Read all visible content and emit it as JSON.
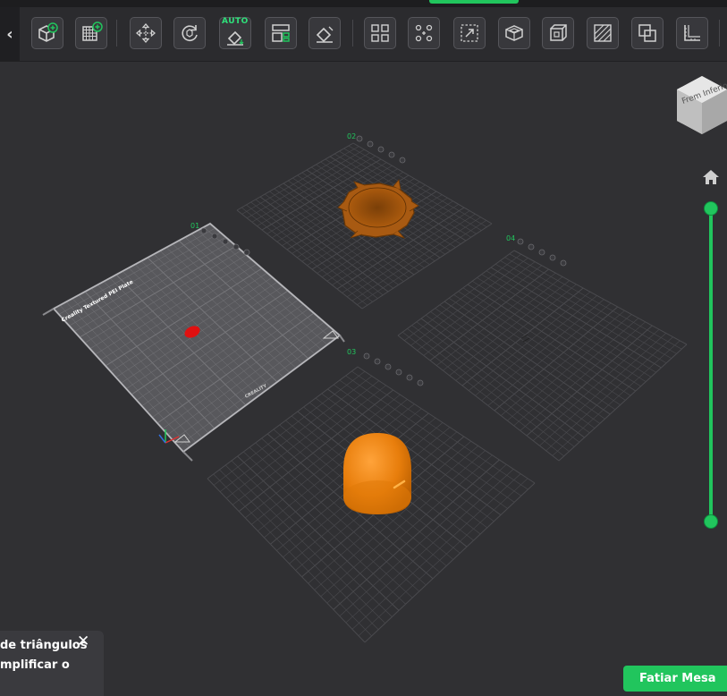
{
  "toolbar": {
    "collapse_glyph": "‹",
    "auto_label": "AUTO",
    "buttons": [
      {
        "name": "add-model-button",
        "icon": "cube-plus-icon"
      },
      {
        "name": "add-plate-button",
        "icon": "grid-plus-icon"
      },
      {
        "name": "move-button",
        "icon": "move-arrows-icon"
      },
      {
        "name": "rotate-button",
        "icon": "rotate-icon"
      },
      {
        "name": "auto-orient-button",
        "icon": "auto-orient-icon"
      },
      {
        "name": "arrange-button",
        "icon": "arrange-icon"
      },
      {
        "name": "lay-on-face-button",
        "icon": "lay-flat-icon"
      },
      {
        "name": "split-button",
        "icon": "split-grid-icon"
      },
      {
        "name": "distribute-button",
        "icon": "distribute-icon"
      },
      {
        "name": "scale-button",
        "icon": "scale-icon"
      },
      {
        "name": "hollow-button",
        "icon": "hollow-box-icon"
      },
      {
        "name": "cut-button",
        "icon": "cut-cube-icon"
      },
      {
        "name": "support-button",
        "icon": "hatch-icon"
      },
      {
        "name": "boolean-button",
        "icon": "boolean-icon"
      },
      {
        "name": "measure-button",
        "icon": "measure-icon"
      }
    ]
  },
  "plates": {
    "p1": {
      "label": "01",
      "bed_text": "Creality Textured PEI Plate",
      "brand": "CREALITY"
    },
    "p2": {
      "label": "02"
    },
    "p3": {
      "label": "03"
    },
    "p4": {
      "label": "04"
    }
  },
  "viewcube": {
    "face_text": "Frem Inferior"
  },
  "slider": {
    "top_level": 1.0,
    "bottom_level": 0.0
  },
  "notice": {
    "line1": "de triângulos",
    "line2": "mplificar o",
    "close_glyph": "✕"
  },
  "slice_button": {
    "label": "Fatiar Mesa"
  },
  "colors": {
    "accent": "#21c55d",
    "model_orange": "#e87e0c",
    "model_brown": "#8b4a0a",
    "model_red": "#e01010",
    "background": "#303033"
  }
}
